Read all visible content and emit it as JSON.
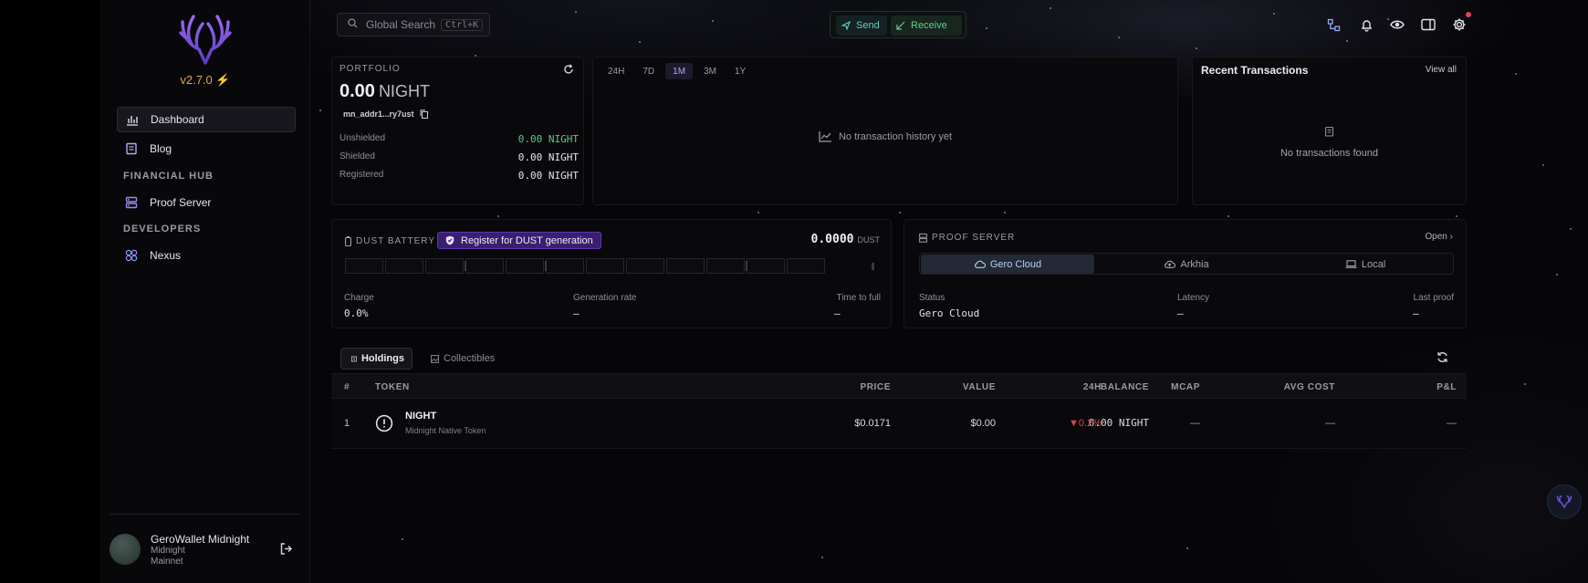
{
  "app": {
    "version": "v2.7.0"
  },
  "topbar": {
    "search_placeholder": "Global Search",
    "search_shortcut": "Ctrl+K",
    "send_label": "Send",
    "receive_label": "Receive"
  },
  "sidebar": {
    "items": [
      {
        "label": "Dashboard",
        "icon": "chart-bars-icon",
        "active": true
      },
      {
        "label": "Blog",
        "icon": "document-icon"
      },
      {
        "label": "Proof Server",
        "icon": "server-icon"
      },
      {
        "label": "Nexus",
        "icon": "nexus-icon"
      }
    ],
    "sections": {
      "financial": "FINANCIAL HUB",
      "developers": "DEVELOPERS"
    },
    "user": {
      "name": "GeroWallet Midnight",
      "network": "Midnight",
      "env": "Mainnet"
    }
  },
  "portfolio": {
    "heading": "PORTFOLIO",
    "amount": "0.00",
    "unit": "NIGHT",
    "address": "mn_addr1...ry7ust",
    "rows": [
      {
        "label": "Unshielded",
        "value": "0.00 NIGHT"
      },
      {
        "label": "Shielded",
        "value": "0.00 NIGHT"
      },
      {
        "label": "Registered",
        "value": "0.00 NIGHT"
      }
    ]
  },
  "history": {
    "ranges": [
      "24H",
      "7D",
      "1M",
      "3M",
      "1Y"
    ],
    "active_range": "1M",
    "empty_text": "No transaction history yet"
  },
  "recent": {
    "title": "Recent Transactions",
    "view_all": "View all",
    "empty_text": "No transactions found"
  },
  "dust": {
    "heading": "DUST BATTERY",
    "register_label": "Register for DUST generation",
    "value": "0.0000",
    "unit": "DUST",
    "charge_fraction": 0,
    "stats": [
      {
        "label": "Charge",
        "value": "0.0%"
      },
      {
        "label": "Generation rate",
        "value": "—"
      },
      {
        "label": "Time to full",
        "value": "—"
      }
    ]
  },
  "proof_server": {
    "heading": "PROOF SERVER",
    "open_label": "Open",
    "tabs": [
      "Gero Cloud",
      "Arkhia",
      "Local"
    ],
    "active_tab": "Gero Cloud",
    "stats": [
      {
        "label": "Status",
        "value": "Gero Cloud"
      },
      {
        "label": "Latency",
        "value": "—"
      },
      {
        "label": "Last proof",
        "value": "—"
      }
    ]
  },
  "holdings": {
    "tabs": [
      "Holdings",
      "Collectibles"
    ],
    "columns": [
      "#",
      "TOKEN",
      "BALANCE",
      "PRICE",
      "VALUE",
      "24H",
      "MCAP",
      "AVG COST",
      "P&L"
    ],
    "rows": [
      {
        "index": "1",
        "name": "NIGHT",
        "subtitle": "Midnight Native Token",
        "balance": "0.00 NIGHT",
        "price": "$0.0171",
        "value": "$0.00",
        "change": "▼0.2%",
        "mcap": "—",
        "avg_cost": "—",
        "pnl": "—"
      }
    ]
  },
  "colors": {
    "accent_purple": "#3a1e70",
    "positive_green": "#62c886",
    "negative_red": "#e0404a",
    "version_gold": "#d9a844"
  }
}
